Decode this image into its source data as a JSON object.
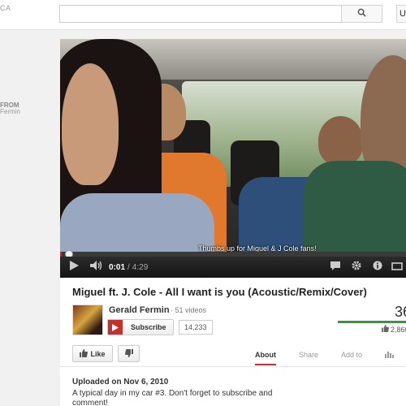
{
  "masthead": {
    "left_text": "CA",
    "search_value": "",
    "right_text": "U"
  },
  "sidebar": {
    "from_label": "FROM",
    "from_name": "Fermin"
  },
  "player": {
    "caption": "Thumbs up for Miguel & J Cole fans!",
    "time_current": "0:01",
    "time_separator": "/",
    "time_duration": "4:29",
    "progress": 0.004,
    "icons": [
      "play-icon",
      "volume-icon",
      "captions-icon",
      "settings-icon",
      "info-icon",
      "size-icon"
    ]
  },
  "video": {
    "title": "Miguel ft. J. Cole - All I want is you (Acoustic/Remix/Cover)",
    "channel_name": "Gerald Fermin",
    "video_count": "· 51 videos",
    "subscribe_label": "Subscribe",
    "subscriber_count": "14,233",
    "views": "36",
    "likes": "2,860",
    "like_ratio": 0.98
  },
  "actions": {
    "like_label": "Like"
  },
  "tabs": [
    {
      "label": "About",
      "active": true
    },
    {
      "label": "Share",
      "active": false
    },
    {
      "label": "Add to",
      "active": false
    }
  ],
  "description": {
    "upload_date": "Uploaded on Nov 6, 2010",
    "text": "A typical day in my car #3. Don't forget to subscribe and comment!"
  },
  "colors": {
    "accent": "#c4302b",
    "like_green": "#2b9e36"
  }
}
